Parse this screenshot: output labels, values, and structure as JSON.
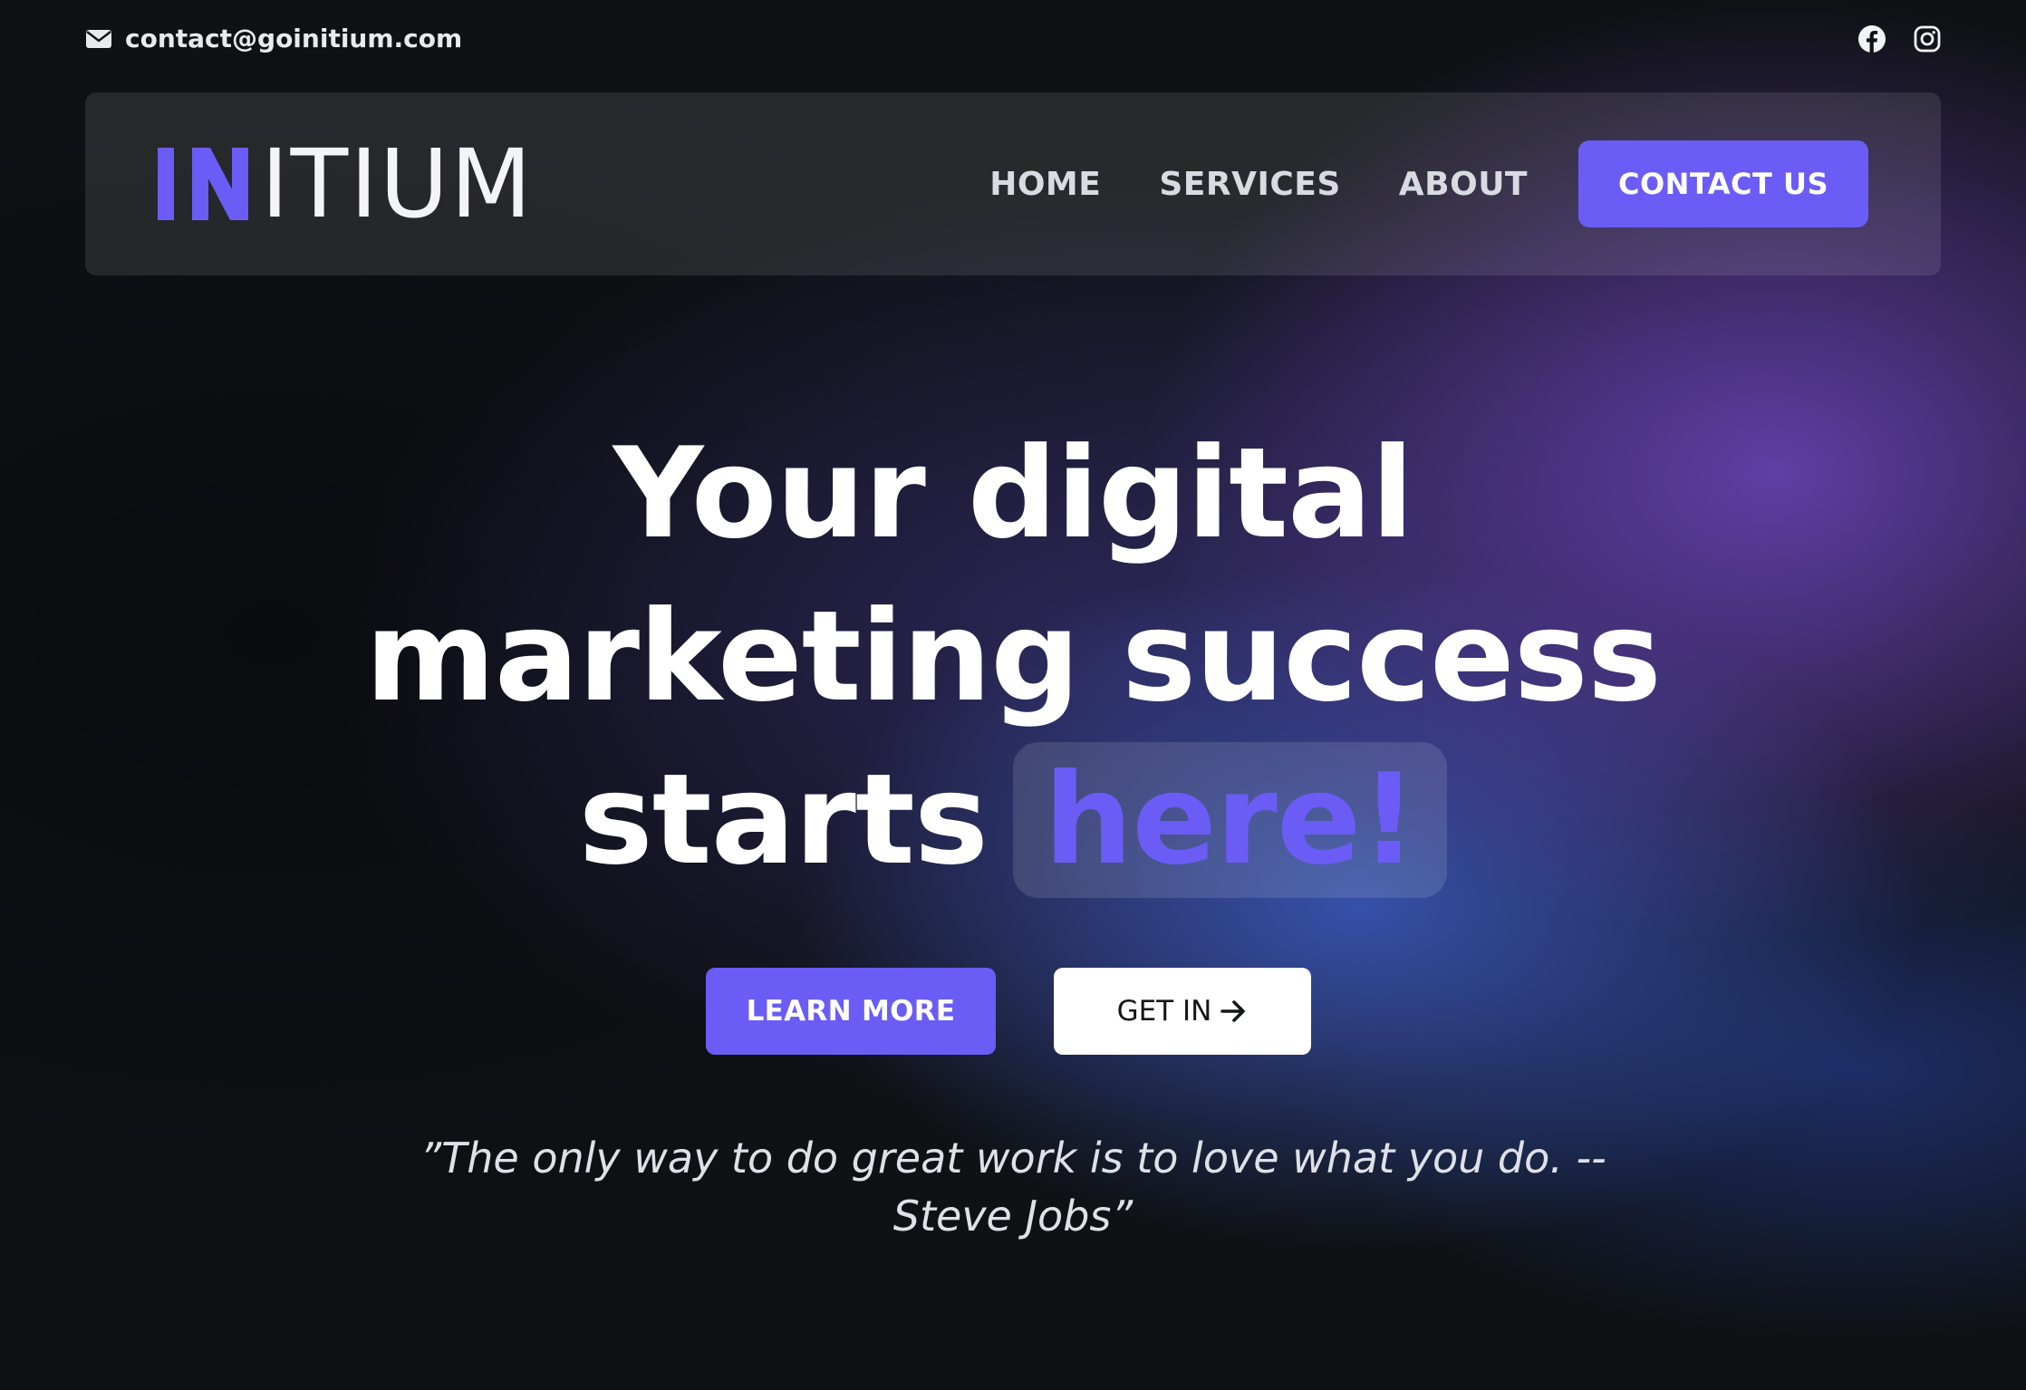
{
  "topbar": {
    "email": "contact@goinitium.com",
    "icons": {
      "mail": "envelope-icon",
      "facebook": "facebook-icon",
      "instagram": "instagram-icon"
    }
  },
  "logo": {
    "text": "ITIUM",
    "mark": "IN",
    "accent_color": "#6b5cf5"
  },
  "nav": {
    "items": [
      {
        "label": "HOME"
      },
      {
        "label": "SERVICES"
      },
      {
        "label": "ABOUT"
      }
    ],
    "cta_label": "CONTACT US"
  },
  "hero": {
    "line1": "Your digital",
    "line2": "marketing success",
    "line3_prefix": "starts",
    "line3_highlight": "here!"
  },
  "buttons": {
    "learn_more": "LEARN MORE",
    "get_in": "GET IN",
    "get_in_icon": "arrow-right-icon"
  },
  "quote": {
    "text": "”The only way to do great work is to love what you do. --Steve Jobs”"
  },
  "colors": {
    "accent": "#6b5cf5",
    "background": "#0f1114",
    "text": "#ffffff"
  }
}
